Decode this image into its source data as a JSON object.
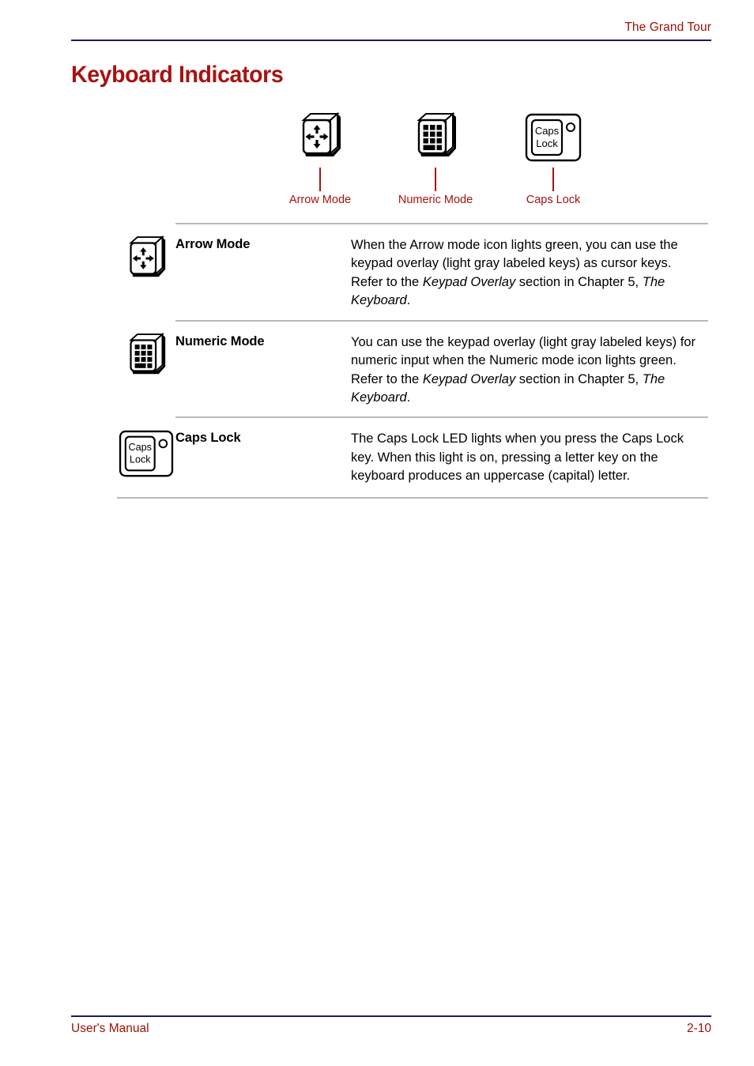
{
  "header": {
    "chapter_title": "The Grand Tour"
  },
  "page_title": "Keyboard Indicators",
  "figure": {
    "callouts": [
      {
        "icon": "arrow-mode-keycap-icon",
        "label": "Arrow Mode"
      },
      {
        "icon": "numeric-mode-keycap-icon",
        "label": "Numeric Mode"
      },
      {
        "icon": "caps-lock-key-icon",
        "label": "Caps Lock"
      }
    ]
  },
  "definitions": [
    {
      "icon": "arrow-mode-keycap-icon",
      "term": "Arrow Mode",
      "description_parts": [
        {
          "text": "When the Arrow mode icon lights green, you can use the keypad overlay (light gray labeled keys) as cursor keys. Refer to the ",
          "italic": false
        },
        {
          "text": "Keypad Overlay",
          "italic": true
        },
        {
          "text": " section in Chapter 5, ",
          "italic": false
        },
        {
          "text": "The Keyboard",
          "italic": true
        },
        {
          "text": ".",
          "italic": false
        }
      ]
    },
    {
      "icon": "numeric-mode-keycap-icon",
      "term": "Numeric Mode",
      "description_parts": [
        {
          "text": "You can use the keypad overlay (light gray labeled keys) for numeric input when the Numeric mode icon lights green. Refer to the ",
          "italic": false
        },
        {
          "text": "Keypad Overlay",
          "italic": true
        },
        {
          "text": " section in Chapter 5, ",
          "italic": false
        },
        {
          "text": "The Keyboard",
          "italic": true
        },
        {
          "text": ".",
          "italic": false
        }
      ]
    },
    {
      "icon": "caps-lock-key-icon",
      "term": "Caps Lock",
      "description_parts": [
        {
          "text": "The Caps Lock LED lights when you press the Caps Lock key. When this light is on, pressing a letter key on the keyboard produces an uppercase (capital) letter.",
          "italic": false
        }
      ]
    }
  ],
  "caps_key_label": {
    "line1": "Caps",
    "line2": "Lock"
  },
  "footer": {
    "manual_label": "User's Manual",
    "page_number": "2-10"
  },
  "colors": {
    "accent_red": "#a81212",
    "header_red": "#9c1006",
    "rule_navy": "#1b1b64",
    "table_rule_gray": "#b9b9b9",
    "body_text": "#000000"
  }
}
